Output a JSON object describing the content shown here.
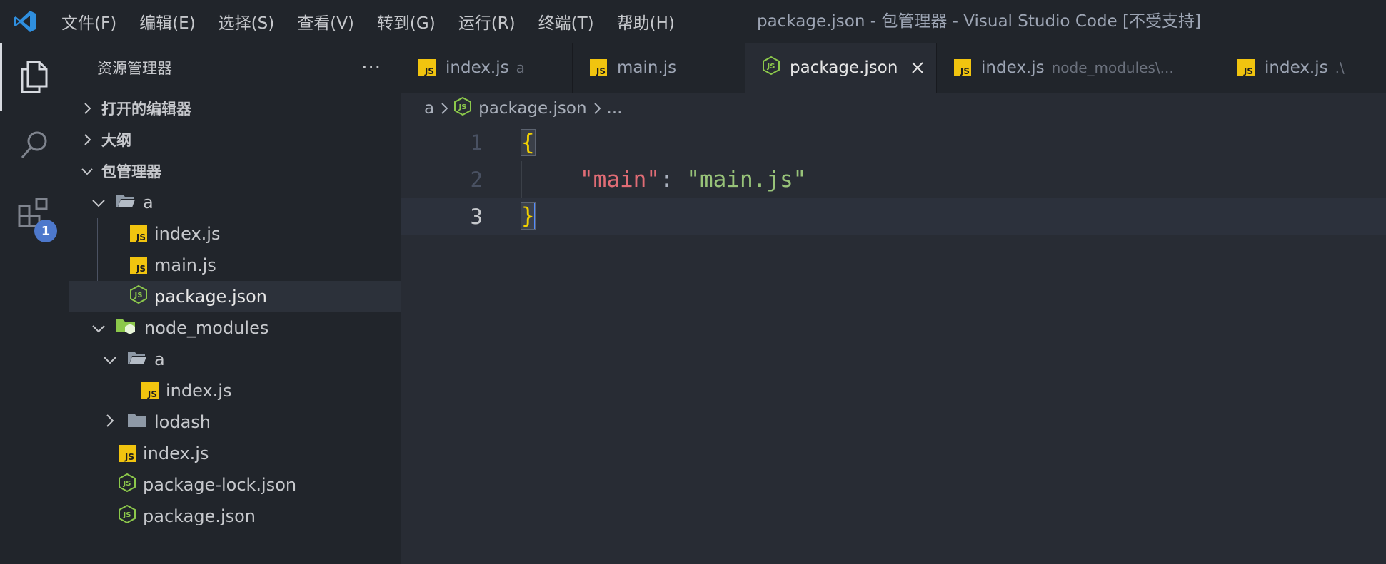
{
  "window": {
    "title": "package.json - 包管理器 - Visual Studio Code [不受支持]",
    "accent": "#4d78cc"
  },
  "menu": [
    "文件(F)",
    "编辑(E)",
    "选择(S)",
    "查看(V)",
    "转到(G)",
    "运行(R)",
    "终端(T)",
    "帮助(H)"
  ],
  "activity": {
    "items": [
      "explorer-icon",
      "search-icon",
      "extensions-icon"
    ],
    "extensions_badge": "1"
  },
  "sidebar": {
    "title": "资源管理器",
    "more": "···",
    "sections": {
      "open_editors": "打开的编辑器",
      "outline": "大纲",
      "workspace": "包管理器"
    },
    "tree": {
      "a": "a",
      "a_index": "index.js",
      "a_main": "main.js",
      "a_package": "package.json",
      "node_modules": "node_modules",
      "nm_a": "a",
      "nm_a_index": "index.js",
      "nm_lodash": "lodash",
      "root_index": "index.js",
      "root_lock": "package-lock.json",
      "root_package": "package.json"
    }
  },
  "tabs": [
    {
      "name": "index.js",
      "desc": "a",
      "icon": "js-icon"
    },
    {
      "name": "main.js",
      "desc": "",
      "icon": "js-icon"
    },
    {
      "name": "package.json",
      "desc": "",
      "icon": "nodejs-icon",
      "active": true,
      "close": "✕"
    },
    {
      "name": "index.js",
      "desc": "node_modules\\...",
      "icon": "js-icon"
    },
    {
      "name": "index.js",
      "desc": ".\\",
      "icon": "js-icon"
    }
  ],
  "breadcrumb": {
    "folder": "a",
    "file": "package.json",
    "more": "..."
  },
  "editor": {
    "lines": [
      {
        "num": "1",
        "open": "{"
      },
      {
        "num": "2",
        "key": "\"main\"",
        "colon": ": ",
        "value": "\"main.js\""
      },
      {
        "num": "3",
        "close": "}"
      }
    ]
  }
}
